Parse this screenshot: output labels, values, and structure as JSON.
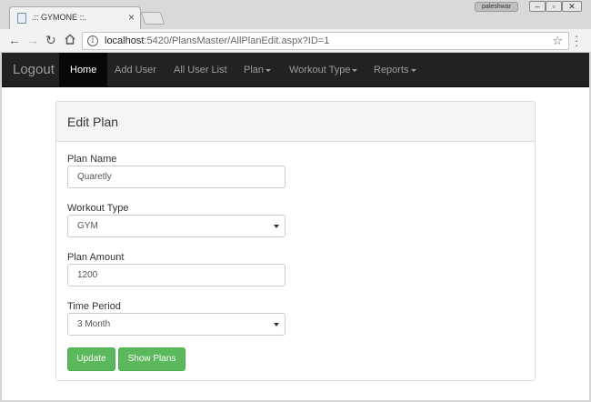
{
  "browser": {
    "tab_title": ".:: GYMONE ::.",
    "tab_close": "×",
    "user_badge": "paleshwar",
    "url_host": "localhost",
    "url_path": ":5420/PlansMaster/AllPlanEdit.aspx?ID=1",
    "window_controls": [
      "‒",
      "▫",
      "✕"
    ],
    "icons": [
      "favicon-icon",
      "back-icon",
      "forward-icon",
      "reload-icon",
      "home-icon",
      "info-icon",
      "star-icon",
      "menu-icon"
    ]
  },
  "navbar": {
    "brand": "Logout",
    "items": [
      {
        "label": "Home",
        "active": true
      },
      {
        "label": "Add User"
      },
      {
        "label": "All User List"
      },
      {
        "label": "Plan",
        "dropdown": true
      },
      {
        "label": "Workout Type",
        "dropdown": true
      },
      {
        "label": "Reports",
        "dropdown": true
      }
    ]
  },
  "panel": {
    "title": "Edit Plan",
    "fields": {
      "plan_name": {
        "label": "Plan Name",
        "value": "Quaretly"
      },
      "workout_type": {
        "label": "Workout Type",
        "value": "GYM"
      },
      "plan_amount": {
        "label": "Plan Amount",
        "value": "1200"
      },
      "time_period": {
        "label": "Time Period",
        "value": "3 Month"
      }
    },
    "buttons": {
      "update": "Update",
      "show_plans": "Show Plans"
    }
  },
  "colors": {
    "navbar_bg": "#222222",
    "button_success": "#5cb85c"
  }
}
